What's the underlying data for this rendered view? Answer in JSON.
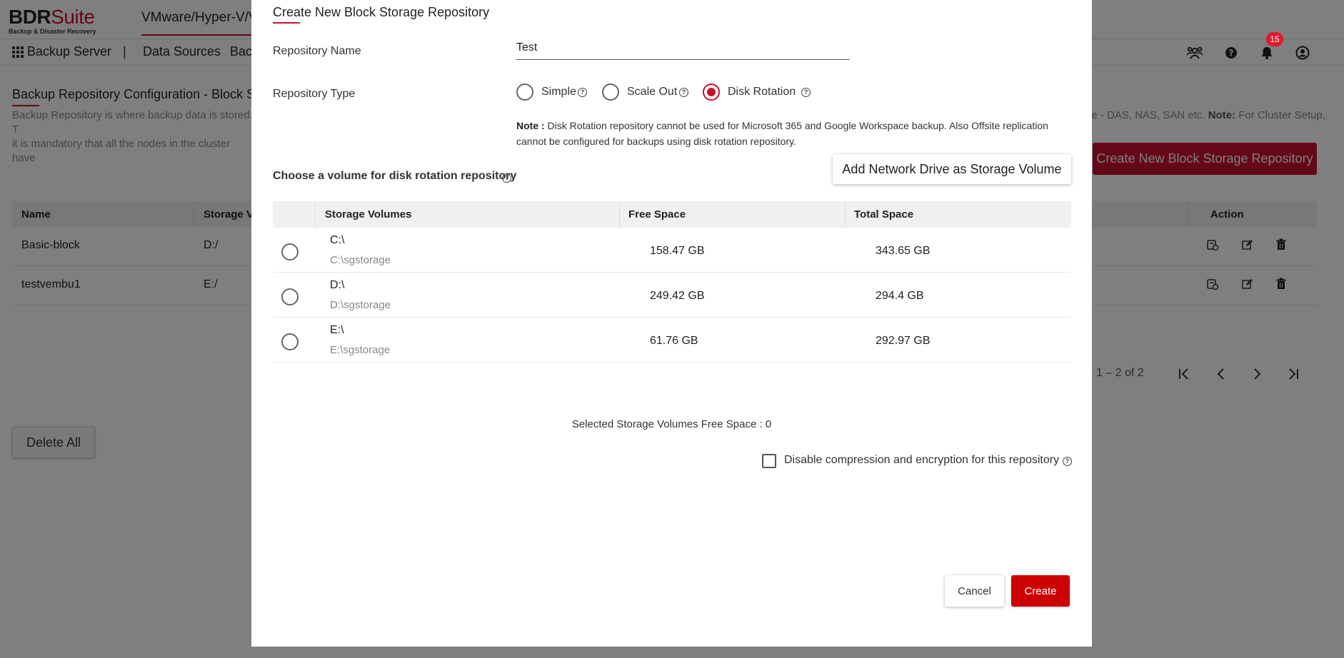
{
  "app": {
    "brand_main": "BDR",
    "brand_accent": "Suite",
    "tagline": "Backup & Disaster Recovery",
    "product_tab": "VMware/Hyper-V/V",
    "accent_color": "#c8102e"
  },
  "nav": {
    "server": "Backup Server",
    "separator": "|",
    "data_sources": "Data Sources",
    "backup_partial": "Bac",
    "notification_count": "15",
    "icons": [
      "users-icon",
      "help-icon",
      "bell-icon",
      "account-icon"
    ]
  },
  "page": {
    "title": "Backup Repository Configuration - Block Sto",
    "desc_line1": "Backup Repository is where backup data is stored. T",
    "desc_line2": "it is mandatory that all the nodes in the cluster have",
    "desc_right_prefix": "ge - DAS, NAS, SAN etc. ",
    "desc_right_note": "Note:",
    "desc_right_suffix": " For Cluster Setup,",
    "create_button": "Create New Block Storage Repository",
    "table_headers": {
      "name": "Name",
      "storage": "Storage Vo",
      "action": "Action"
    },
    "rows": [
      {
        "name": "Basic-block",
        "storage": "D:/"
      },
      {
        "name": "testvembu1",
        "storage": "E:/"
      }
    ],
    "pager": "1 – 2 of 2",
    "delete_all": "Delete All"
  },
  "modal": {
    "title": "Create New Block Storage Repository",
    "repo_name_label": "Repository Name",
    "repo_name_value": "Test",
    "repo_type_label": "Repository Type",
    "types": [
      {
        "label": "Simple",
        "selected": false
      },
      {
        "label": "Scale Out",
        "selected": false
      },
      {
        "label": "Disk Rotation",
        "selected": true
      }
    ],
    "note_label": "Note :",
    "note_text": " Disk Rotation repository cannot be used for Microsoft 365 and Google Workspace backup. Also Offsite replication cannot be configured for backups using disk rotation repository.",
    "choose_label": "Choose a volume for disk rotation repository",
    "add_network_button": "Add Network Drive as Storage Volume",
    "volume_headers": {
      "volumes": "Storage Volumes",
      "free": "Free Space",
      "total": "Total Space"
    },
    "volumes": [
      {
        "name": "C:\\",
        "path": "C:\\sgstorage",
        "free": "158.47 GB",
        "total": "343.65 GB"
      },
      {
        "name": "D:\\",
        "path": "D:\\sgstorage",
        "free": "249.42 GB",
        "total": "294.4 GB"
      },
      {
        "name": "E:\\",
        "path": "E:\\sgstorage",
        "free": "61.76 GB",
        "total": "292.97 GB"
      }
    ],
    "selected_free": "Selected Storage Volumes Free Space : 0",
    "disable_label": "Disable compression and encryption for this repository",
    "disable_checked": false,
    "cancel": "Cancel",
    "create": "Create"
  }
}
